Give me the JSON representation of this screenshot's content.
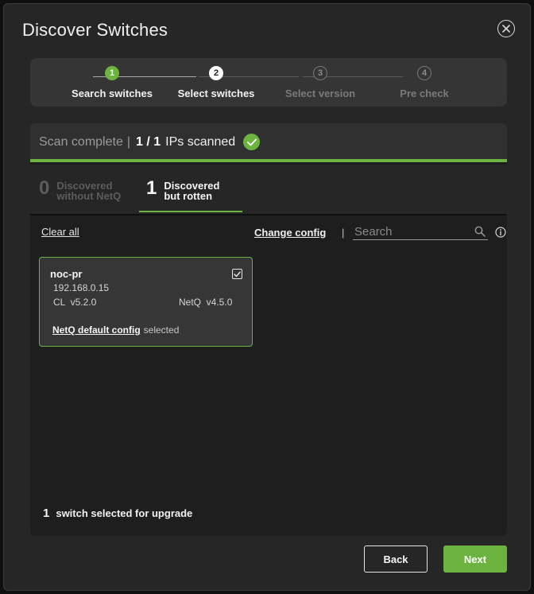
{
  "dialog": {
    "title": "Discover Switches",
    "close_icon": "close-circle-icon"
  },
  "stepper": {
    "steps": [
      {
        "number": "1",
        "label": "Search switches",
        "state": "completed"
      },
      {
        "number": "2",
        "label": "Select switches",
        "state": "current"
      },
      {
        "number": "3",
        "label": "Select version",
        "state": "pending"
      },
      {
        "number": "4",
        "label": "Pre check",
        "state": "pending"
      }
    ]
  },
  "scan": {
    "status": "Scan complete",
    "separator": "|",
    "count": "1 / 1",
    "label": "IPs scanned",
    "progress_fraction": 1.0,
    "status_icon": "check-circle-icon"
  },
  "tabs": [
    {
      "count": "0",
      "label_line1": "Discovered",
      "label_line2": "without NetQ",
      "active": false
    },
    {
      "count": "1",
      "label_line1": "Discovered",
      "label_line2": "but rotten",
      "active": true
    }
  ],
  "toolbar": {
    "clear_all": "Clear all",
    "change_config": "Change config",
    "separator": "|",
    "search_placeholder": "Search",
    "search_icon": "search-icon",
    "info_icon": "info-icon"
  },
  "switches": [
    {
      "name": "noc-pr",
      "ip": "192.168.0.15",
      "cl": "CL  v5.2.0",
      "netq": "NetQ  v4.5.0",
      "config_link": "NetQ default config",
      "config_state": "selected",
      "checked": true
    }
  ],
  "footer": {
    "selected_count": "1",
    "selected_text": "switch selected for upgrade"
  },
  "buttons": {
    "back": "Back",
    "next": "Next"
  },
  "colors": {
    "accent": "#6db33f",
    "dialog_bg": "#262626",
    "panel_bg": "#1e1e1e"
  }
}
